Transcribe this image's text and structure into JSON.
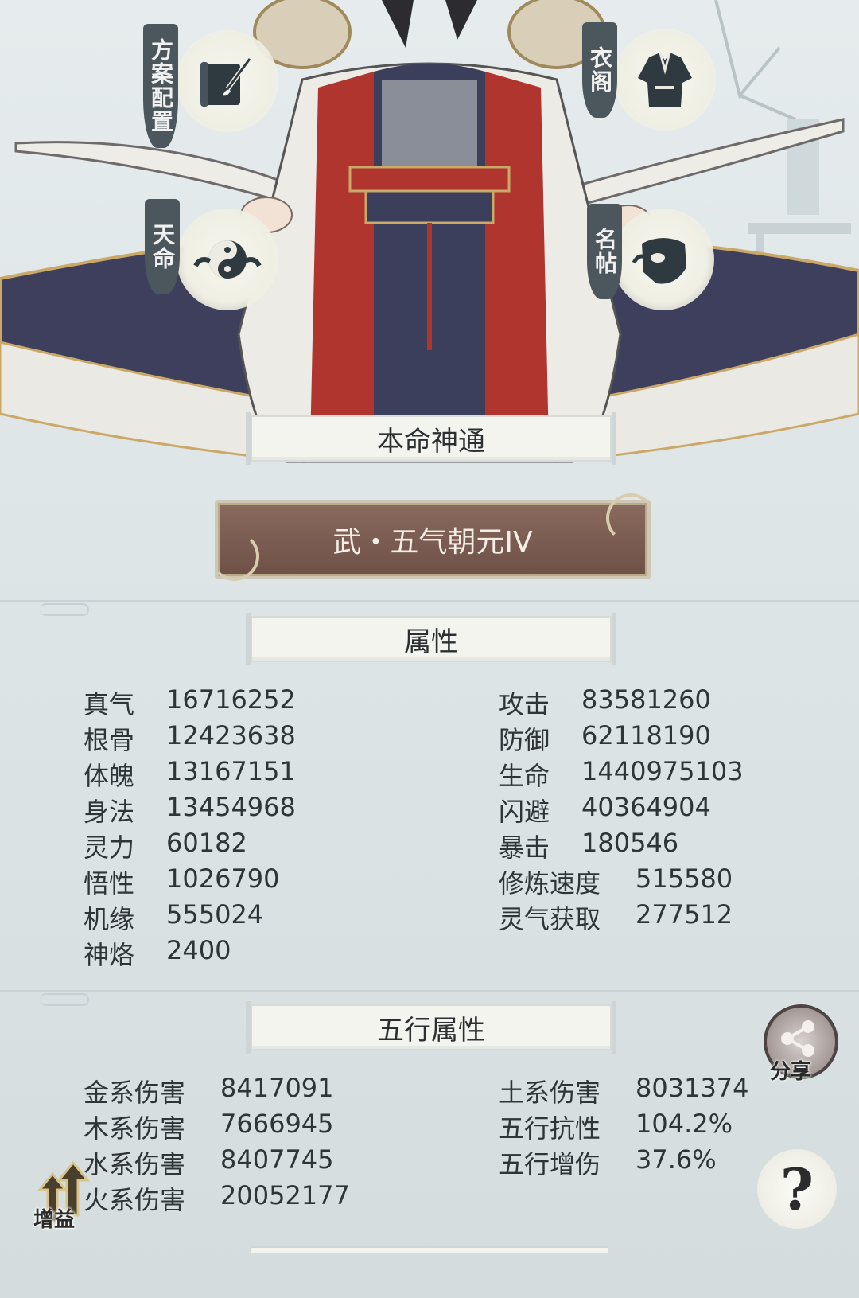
{
  "buttons": {
    "plan_config": "方案配置",
    "wardrobe": "衣阁",
    "destiny": "天命",
    "name_card": "名帖",
    "share": "分享",
    "help": "?",
    "buff": "增益"
  },
  "sections": {
    "innate_skill_title": "本命神通",
    "skill_name": "武・五气朝元IV",
    "attributes_title": "属性",
    "five_elements_title": "五行属性"
  },
  "attributes_left": [
    {
      "label": "真气",
      "value": "16716252"
    },
    {
      "label": "根骨",
      "value": "12423638"
    },
    {
      "label": "体魄",
      "value": "13167151"
    },
    {
      "label": "身法",
      "value": "13454968"
    },
    {
      "label": "灵力",
      "value": "60182"
    },
    {
      "label": "悟性",
      "value": "1026790"
    },
    {
      "label": "机缘",
      "value": "555024"
    },
    {
      "label": "神烙",
      "value": "2400"
    }
  ],
  "attributes_right": [
    {
      "label": "攻击",
      "value": "83581260"
    },
    {
      "label": "防御",
      "value": "62118190"
    },
    {
      "label": "生命",
      "value": "1440975103"
    },
    {
      "label": "闪避",
      "value": "40364904"
    },
    {
      "label": "暴击",
      "value": "180546"
    },
    {
      "label": "修炼速度",
      "value": "515580"
    },
    {
      "label": "灵气获取",
      "value": "277512"
    }
  ],
  "elements_left": [
    {
      "label": "金系伤害",
      "value": "8417091"
    },
    {
      "label": "木系伤害",
      "value": "7666945"
    },
    {
      "label": "水系伤害",
      "value": "8407745"
    },
    {
      "label": "火系伤害",
      "value": "20052177"
    }
  ],
  "elements_right": [
    {
      "label": "土系伤害",
      "value": "8031374"
    },
    {
      "label": "五行抗性",
      "value": "104.2%"
    },
    {
      "label": "五行增伤",
      "value": "37.6%"
    }
  ],
  "colors": {
    "background": "#dde5e7",
    "robe_red": "#b0352f",
    "robe_navy": "#3c3f5c",
    "gold_trim": "#c9b27a",
    "plate_brown": "#7a5a4f"
  }
}
